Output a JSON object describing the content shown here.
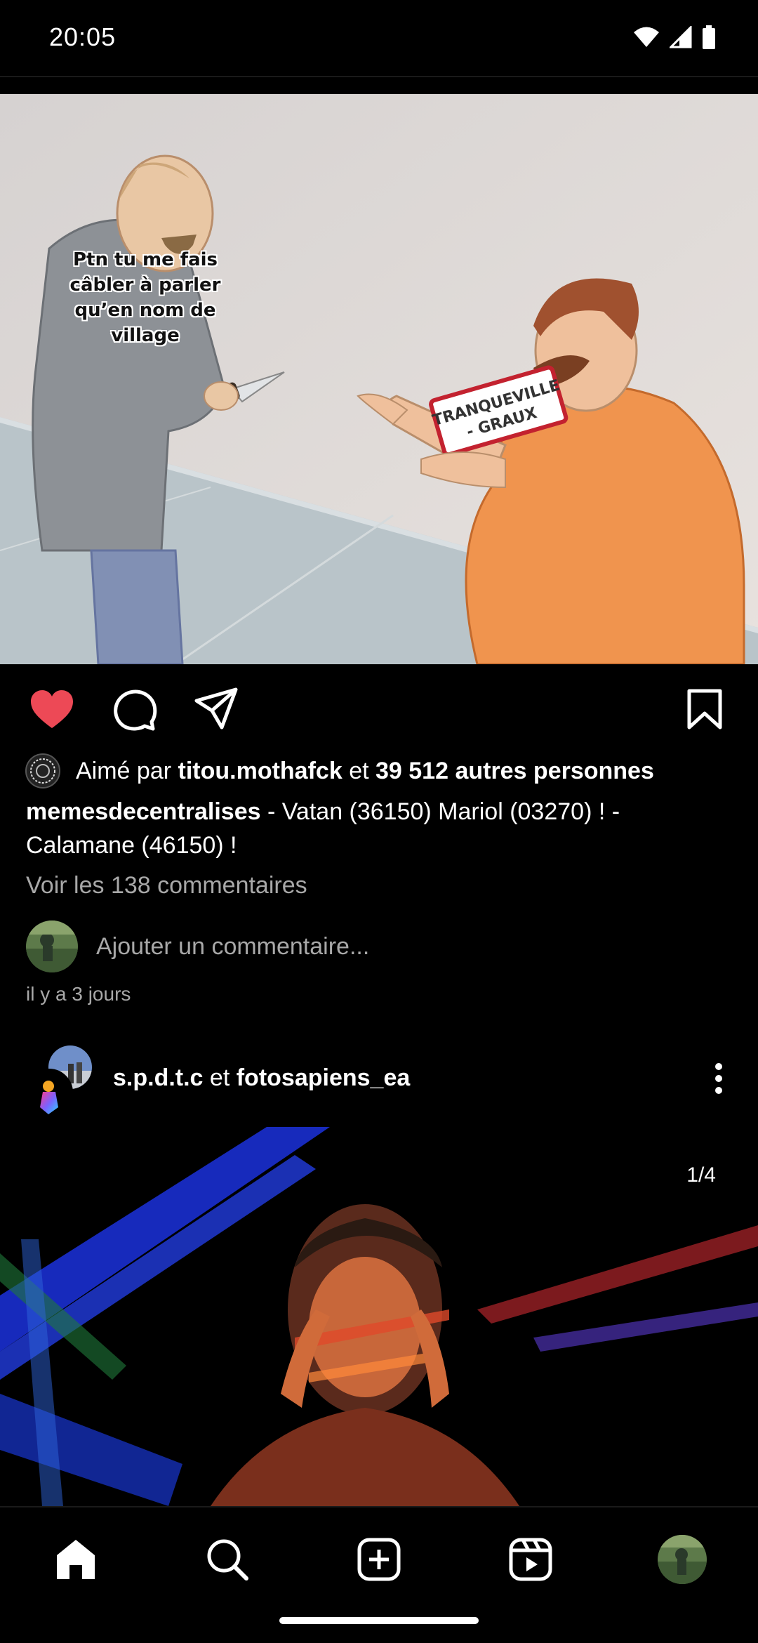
{
  "status_bar": {
    "time": "20:05"
  },
  "post1": {
    "meme_caption": "Ptn tu me fais câbler à parler qu’en nom de village",
    "sign_text": "TRANQUEVILLE - GRAUX",
    "likes": {
      "prefix": "Aimé par",
      "user": "titou.mothafck",
      "joiner": "et",
      "others": "39 512 autres personnes"
    },
    "caption": {
      "username": "memesdecentralises",
      "text": "- Vatan (36150) Mariol (03270) ! - Calamane (46150) !"
    },
    "view_comments": "Voir les 138 commentaires",
    "comment_placeholder": "Ajouter un commentaire...",
    "time_ago": "il y a 3 jours",
    "liked": true,
    "accent_like": "#ed4956"
  },
  "post2": {
    "user1": "s.p.d.t.c",
    "joiner": "et",
    "user2": "fotosapiens_ea",
    "counter": "1/4"
  },
  "nav": {
    "items": [
      "home-icon",
      "search-icon",
      "create-icon",
      "reels-icon",
      "profile-avatar"
    ]
  }
}
